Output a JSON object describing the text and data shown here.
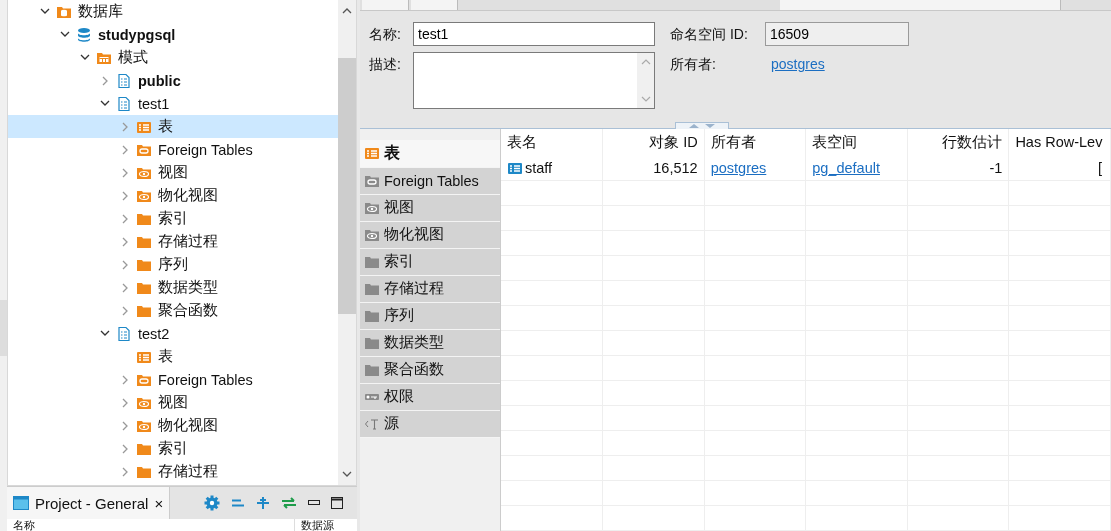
{
  "navigator": {
    "tree": [
      {
        "label": "数据库",
        "kind": "database-folder",
        "expanded": true,
        "bold": false,
        "selected": false,
        "children": [
          {
            "label": "studypgsql",
            "kind": "database",
            "expanded": true,
            "bold": true,
            "selected": false,
            "children": [
              {
                "label": "模式",
                "kind": "schema-folder",
                "expanded": true,
                "bold": false,
                "selected": false,
                "children": [
                  {
                    "label": "public",
                    "kind": "schema",
                    "expanded": false,
                    "bold": true,
                    "selected": false
                  },
                  {
                    "label": "test1",
                    "kind": "schema",
                    "expanded": true,
                    "bold": false,
                    "selected": false,
                    "children": [
                      {
                        "label": "表",
                        "kind": "table-folder",
                        "expanded": false,
                        "bold": false,
                        "selected": true
                      },
                      {
                        "label": "Foreign Tables",
                        "kind": "link-folder",
                        "expanded": false,
                        "bold": false,
                        "selected": false
                      },
                      {
                        "label": "视图",
                        "kind": "view-folder",
                        "expanded": false,
                        "bold": false,
                        "selected": false
                      },
                      {
                        "label": "物化视图",
                        "kind": "view-folder",
                        "expanded": false,
                        "bold": false,
                        "selected": false
                      },
                      {
                        "label": "索引",
                        "kind": "folder",
                        "expanded": false,
                        "bold": false,
                        "selected": false
                      },
                      {
                        "label": "存储过程",
                        "kind": "folder",
                        "expanded": false,
                        "bold": false,
                        "selected": false
                      },
                      {
                        "label": "序列",
                        "kind": "folder",
                        "expanded": false,
                        "bold": false,
                        "selected": false
                      },
                      {
                        "label": "数据类型",
                        "kind": "folder",
                        "expanded": false,
                        "bold": false,
                        "selected": false
                      },
                      {
                        "label": "聚合函数",
                        "kind": "folder",
                        "expanded": false,
                        "bold": false,
                        "selected": false
                      }
                    ]
                  },
                  {
                    "label": "test2",
                    "kind": "schema",
                    "expanded": true,
                    "bold": false,
                    "selected": false,
                    "children": [
                      {
                        "label": "表",
                        "kind": "table-folder",
                        "bold": false,
                        "selected": false
                      },
                      {
                        "label": "Foreign Tables",
                        "kind": "link-folder",
                        "expanded": false,
                        "bold": false,
                        "selected": false
                      },
                      {
                        "label": "视图",
                        "kind": "view-folder",
                        "expanded": false,
                        "bold": false,
                        "selected": false
                      },
                      {
                        "label": "物化视图",
                        "kind": "view-folder",
                        "expanded": false,
                        "bold": false,
                        "selected": false
                      },
                      {
                        "label": "索引",
                        "kind": "folder",
                        "expanded": false,
                        "bold": false,
                        "selected": false
                      },
                      {
                        "label": "存储过程",
                        "kind": "folder",
                        "expanded": false,
                        "bold": false,
                        "selected": false
                      }
                    ]
                  }
                ]
              }
            ]
          }
        ]
      }
    ]
  },
  "project_panel": {
    "tab_title": "Project - General",
    "close": "×",
    "columns": [
      "名称",
      "数据源"
    ]
  },
  "properties": {
    "name_label": "名称:",
    "name_value": "test1",
    "namespace_label": "命名空间 ID:",
    "namespace_value": "16509",
    "description_label": "描述:",
    "owner_label": "所有者:",
    "owner_value": "postgres"
  },
  "object_tabs": [
    {
      "label": "表",
      "kind": "table",
      "selected": true
    },
    {
      "label": "Foreign Tables",
      "kind": "link",
      "selected": false
    },
    {
      "label": "视图",
      "kind": "view",
      "selected": false
    },
    {
      "label": "物化视图",
      "kind": "view",
      "selected": false
    },
    {
      "label": "索引",
      "kind": "folder",
      "selected": false
    },
    {
      "label": "存储过程",
      "kind": "folder",
      "selected": false
    },
    {
      "label": "序列",
      "kind": "folder",
      "selected": false
    },
    {
      "label": "数据类型",
      "kind": "folder",
      "selected": false
    },
    {
      "label": "聚合函数",
      "kind": "folder",
      "selected": false
    },
    {
      "label": "权限",
      "kind": "key",
      "selected": false
    },
    {
      "label": "源",
      "kind": "source",
      "selected": false
    }
  ],
  "table": {
    "columns": [
      {
        "label": "表名",
        "kind": "text"
      },
      {
        "label": "对象 ID",
        "kind": "number"
      },
      {
        "label": "所有者",
        "kind": "text"
      },
      {
        "label": "表空间",
        "kind": "text"
      },
      {
        "label": "行数估计",
        "kind": "number"
      },
      {
        "label": "Has Row-Lev",
        "kind": "text"
      }
    ],
    "rows": [
      [
        {
          "text": "staff",
          "kind": "table"
        },
        {
          "text": "16,512",
          "kind": "text"
        },
        {
          "text": "postgres",
          "kind": "link"
        },
        {
          "text": "pg_default",
          "kind": "link"
        },
        {
          "text": "-1",
          "kind": "text"
        },
        {
          "text": "[",
          "kind": "text-right"
        }
      ]
    ]
  }
}
